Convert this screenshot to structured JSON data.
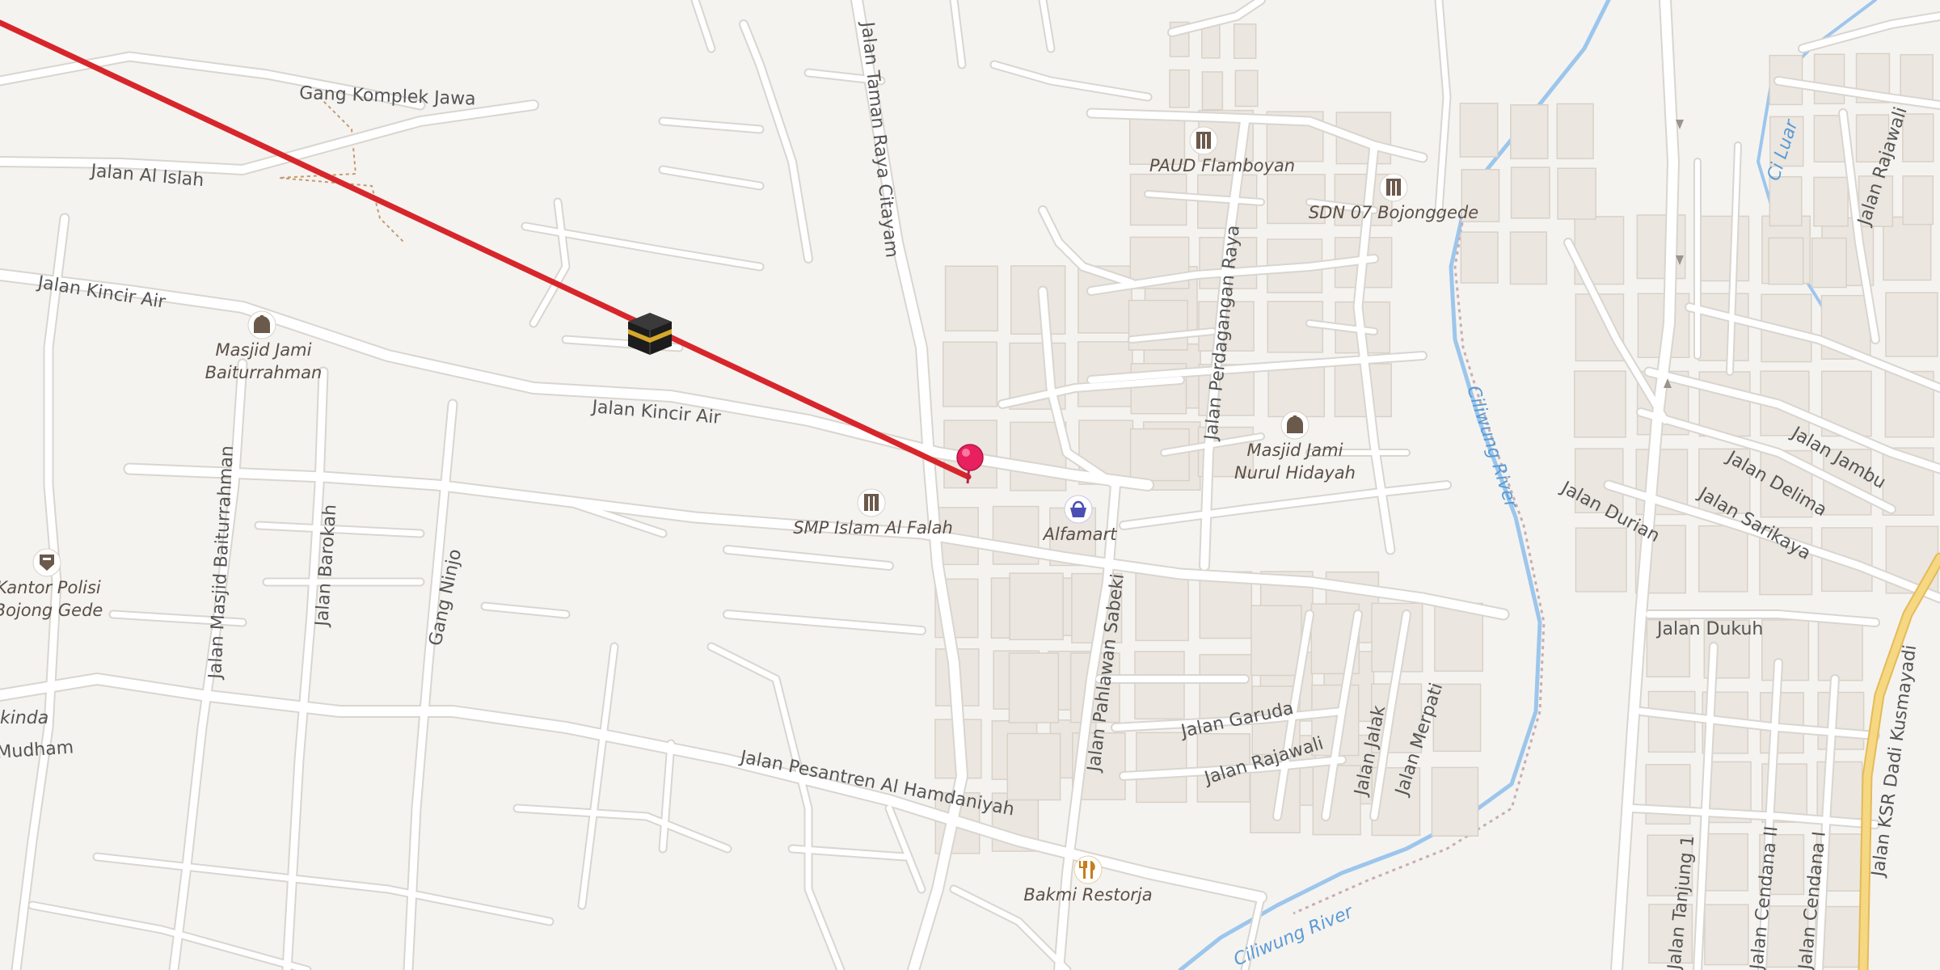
{
  "colors": {
    "background": "#f5f3f0",
    "road": "#ffffff",
    "road_casing": "#d9d5cf",
    "building": "#ebe6df",
    "water": "#9cc6ec",
    "qibla_line": "#d7262b",
    "pin": "#e8205f",
    "major_road": "#f3cf6e"
  },
  "roads": {
    "gang_komplek_jawa": "Gang Komplek Jawa",
    "jalan_al_islah": "Jalan Al Islah",
    "jalan_kincir_air_west": "Jalan Kincir Air",
    "jalan_kincir_air_mid": "Jalan Kincir Air",
    "jalan_taman_raya_citayam": "Jalan Taman Raya Citayam",
    "jalan_masjid_baiturrahman": "Jalan Masjid Baiturrahman",
    "jalan_barokah": "Jalan Barokah",
    "gang_ninjo": "Gang Ninjo",
    "jalan_mudham": "Mudham",
    "jalan_kinda": "kinda",
    "jalan_pesantren": "Jalan Pesantren Al Hamdaniyah",
    "jalan_pahlawan_sabeki": "Jalan Pahlawan Sabeki",
    "jalan_perdagangan_raya": "Jalan Perdagangan Raya",
    "jalan_garuda": "Jalan Garuda",
    "jalan_rajawali_south": "Jalan Rajawali",
    "jalan_jalak": "Jalan Jalak",
    "jalan_merpati": "Jalan Merpati",
    "jalan_durian": "Jalan Durian",
    "jalan_dukuh": "Jalan Dukuh",
    "jalan_jambu": "Jalan Jambu",
    "jalan_delima": "Jalan Delima",
    "jalan_sarikaya": "Jalan Sarikaya",
    "jalan_rajawali_east": "Jalan Rajawali",
    "jalan_tanjung_1": "Jalan Tanjung 1",
    "jalan_cendana_ii": "Jalan Cendana II",
    "jalan_cendana_i": "Jalan Cendana I",
    "jalan_ksr": "Jalan KSR Dadi Kusmayadi"
  },
  "rivers": {
    "ciliwung_north": "Ciliwung River",
    "ciliwung_south": "Ciliwung River",
    "ci_luar": "Ci Luar"
  },
  "pois": {
    "paud_flamboyan": {
      "label": "PAUD Flamboyan",
      "icon": "school-icon"
    },
    "sdn_07": {
      "label": "SDN 07 Bojonggede",
      "icon": "school-icon"
    },
    "masjid_baiturrahman": {
      "label1": "Masjid Jami",
      "label2": "Baiturrahman",
      "icon": "mosque-icon"
    },
    "masjid_nurul_hidayah": {
      "label1": "Masjid Jami",
      "label2": "Nurul Hidayah",
      "icon": "mosque-icon"
    },
    "smp_islam": {
      "label": "SMP Islam Al Falah",
      "icon": "school-icon"
    },
    "alfamart": {
      "label": "Alfamart",
      "icon": "shopping-basket-icon"
    },
    "kantor_polisi": {
      "label1": "Kantor Polisi",
      "label2": "Bojong Gede",
      "icon": "police-icon"
    },
    "bakmi_restorja": {
      "label": "Bakmi Restorja",
      "icon": "restaurant-icon"
    }
  },
  "markers": {
    "qibla": {
      "icon": "kaaba-icon"
    },
    "location": {
      "icon": "location-pin-icon"
    }
  }
}
